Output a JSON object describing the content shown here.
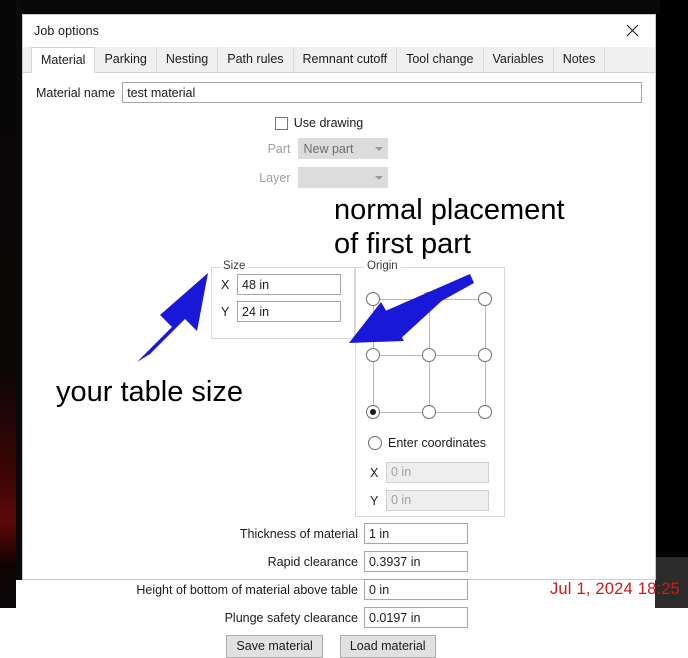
{
  "window": {
    "title": "Job options",
    "close_icon": "close-x-icon"
  },
  "tabs": [
    {
      "label": "Material",
      "active": true
    },
    {
      "label": "Parking",
      "active": false
    },
    {
      "label": "Nesting",
      "active": false
    },
    {
      "label": "Path rules",
      "active": false
    },
    {
      "label": "Remnant cutoff",
      "active": false
    },
    {
      "label": "Tool change",
      "active": false
    },
    {
      "label": "Variables",
      "active": false
    },
    {
      "label": "Notes",
      "active": false
    }
  ],
  "material": {
    "name_label": "Material name",
    "name_value": "test material",
    "use_drawing_label": "Use drawing",
    "use_drawing_checked": false,
    "part_label": "Part",
    "part_value": "New part",
    "part_disabled": true,
    "layer_label": "Layer",
    "layer_value": "",
    "layer_disabled": true
  },
  "size": {
    "legend": "Size",
    "x_label": "X",
    "x_value": "48 in",
    "y_label": "Y",
    "y_value": "24 in"
  },
  "origin": {
    "legend": "Origin",
    "selected_cell": "bottom-left",
    "enter_coordinates_label": "Enter coordinates",
    "enter_coordinates_checked": false,
    "x_label": "X",
    "x_value": "0 in",
    "y_label": "Y",
    "y_value": "0 in",
    "coords_disabled": true
  },
  "fields": [
    {
      "label": "Thickness of material",
      "value": "1 in"
    },
    {
      "label": "Rapid clearance",
      "value": "0.3937 in"
    },
    {
      "label": "Height of bottom of material above table",
      "value": "0 in"
    },
    {
      "label": "Plunge safety clearance",
      "value": "0.0197 in"
    }
  ],
  "buttons": {
    "save": "Save material",
    "load": "Load material"
  },
  "annotations": {
    "normal_placement_line1": "normal placement",
    "normal_placement_line2": "of first part",
    "table_size": "your table size",
    "arrow_color": "#1a18d8"
  },
  "timestamp": "Jul 1, 2024 18:25"
}
